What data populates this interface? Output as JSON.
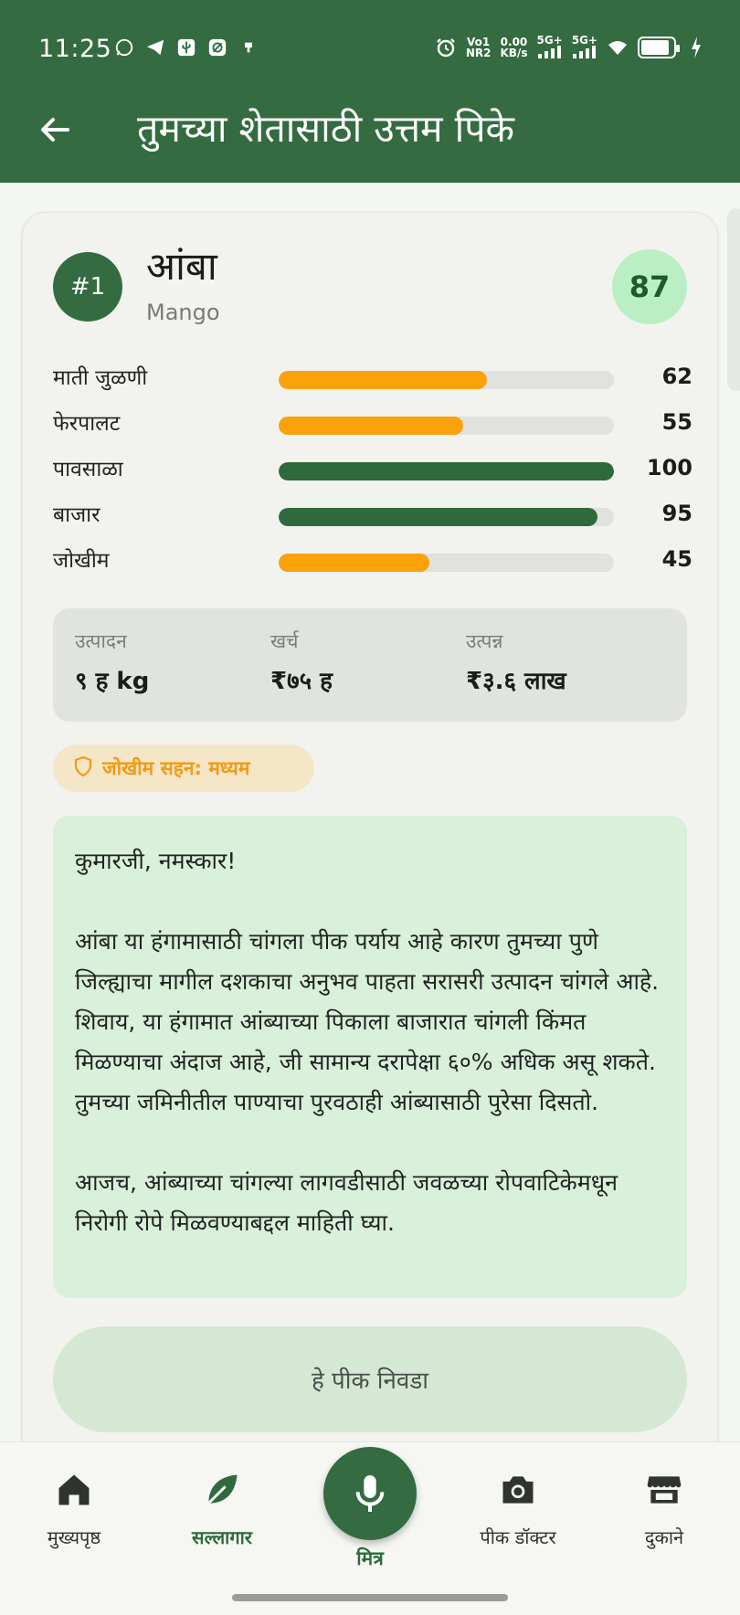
{
  "status_bar": {
    "time": "11:25",
    "net_line1": "Vo1",
    "net_line2": "NR2",
    "speed_line1": "0.00",
    "speed_line2": "KB/s",
    "sig1": "5G+",
    "sig2": "5G+"
  },
  "header": {
    "title": "तुमच्या शेतासाठी उत्तम पिके"
  },
  "crop": {
    "rank": "#1",
    "name": "आंबा",
    "name_en": "Mango",
    "score": "87"
  },
  "metrics": [
    {
      "label": "माती जुळणी",
      "value": 62,
      "display": "62",
      "color": "#f9a20b"
    },
    {
      "label": "फेरपालट",
      "value": 55,
      "display": "55",
      "color": "#f9a20b"
    },
    {
      "label": "पावसाळा",
      "value": 100,
      "display": "100",
      "color": "#2f6a3d"
    },
    {
      "label": "बाजार",
      "value": 95,
      "display": "95",
      "color": "#2f6a3d"
    },
    {
      "label": "जोखीम",
      "value": 45,
      "display": "45",
      "color": "#f9a20b"
    }
  ],
  "stats": {
    "production_label": "उत्पादन",
    "production_value": "९ ह kg",
    "cost_label": "खर्च",
    "cost_value": "₹७५ ह",
    "income_label": "उत्पन्न",
    "income_value": "₹३.६ लाख"
  },
  "risk": {
    "label": "जोखीम सहन: मध्यम",
    "color": "#f39a12"
  },
  "advice": {
    "greeting": "कुमारजी, नमस्कार!",
    "para1": "आंबा या हंगामासाठी चांगला पीक पर्याय आहे कारण तुमच्या पुणे जिल्ह्याचा मागील दशकाचा अनुभव पाहता सरासरी उत्पादन चांगले आहे. शिवाय, या हंगामात आंब्याच्या पिकाला बाजारात चांगली किंमत मिळण्याचा अंदाज आहे, जी सामान्य दरापेक्षा ६०% अधिक असू शकते. तुमच्या जमिनीतील पाण्याचा पुरवठाही आंब्यासाठी पुरेसा दिसतो.",
    "para2": "आजच, आंब्याच्या चांगल्या लागवडीसाठी जवळच्या रोपवाटिकेमधून निरोगी रोपे मिळवण्याबद्दल माहिती घ्या."
  },
  "select_button": "हे पीक निवडा",
  "nav": {
    "home": "मुख्यपृष्ठ",
    "advisor": "सल्लागार",
    "mitra": "मित्र",
    "doctor": "पीक डॉक्टर",
    "shops": "दुकाने"
  },
  "colors": {
    "primary": "#346b40",
    "orange": "#f9a20b",
    "score_bg": "#b9efc2"
  }
}
